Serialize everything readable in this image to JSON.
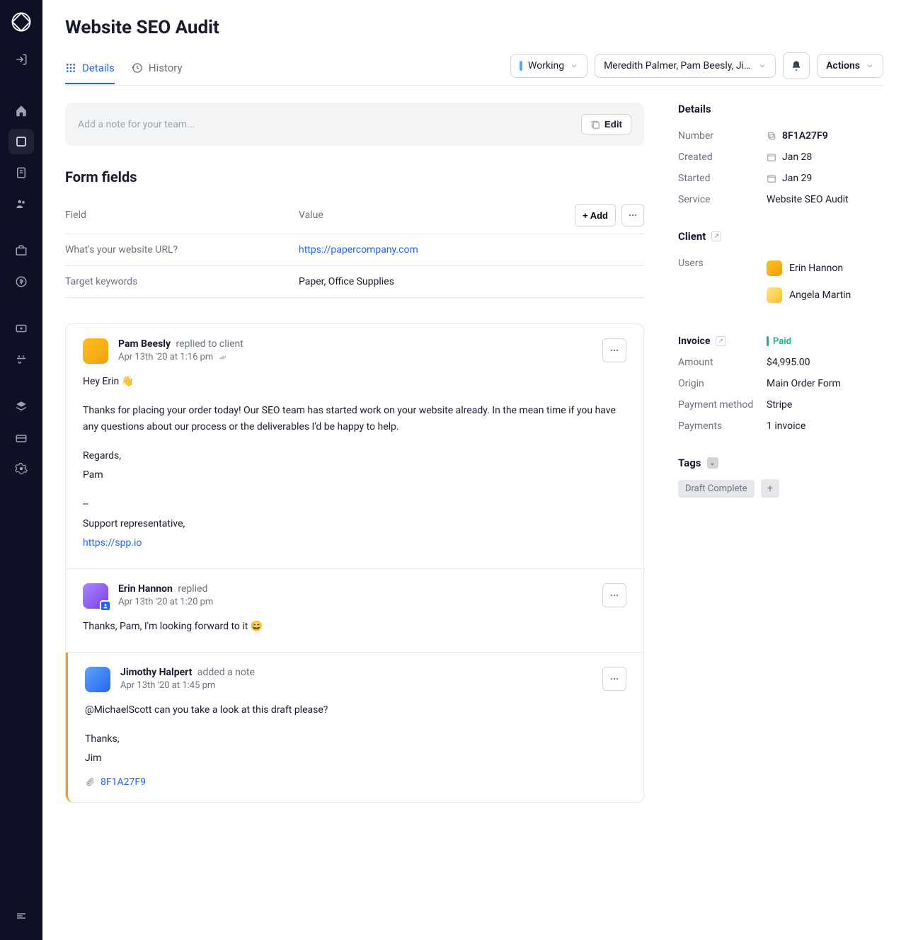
{
  "page": {
    "title": "Website SEO Audit"
  },
  "tabs": {
    "details": "Details",
    "history": "History"
  },
  "topbar": {
    "status": "Working",
    "assignees": "Meredith Palmer, Pam Beesly, Jimothy...",
    "actions": "Actions"
  },
  "note_input": {
    "placeholder": "Add a note for your team...",
    "edit": "Edit"
  },
  "form": {
    "heading": "Form fields",
    "col_field": "Field",
    "col_value": "Value",
    "add": "+ Add",
    "rows": [
      {
        "field": "What's your website URL?",
        "value": "https://papercompany.com",
        "is_link": true
      },
      {
        "field": "Target keywords",
        "value": "Paper, Office Supplies",
        "is_link": false
      }
    ]
  },
  "messages": [
    {
      "author": "Pam Beesly",
      "action": "replied to client",
      "time": "Apr 13th '20 at 1:16 pm",
      "read": true,
      "body": {
        "greeting": "Hey Erin 👋",
        "p1": "Thanks for placing your order today! Our SEO team has started work on your website already. In the mean time if you have any questions about our process or the deliverables I'd be happy to help.",
        "sig1": "Regards,",
        "sig2": "Pam",
        "dash": "--",
        "sig3": "Support representative,",
        "link": "https://spp.io"
      }
    },
    {
      "author": "Erin Hannon",
      "action": "replied",
      "time": "Apr 13th '20 at 1:20 pm",
      "body": {
        "p1": "Thanks, Pam, I'm looking forward to it 😄"
      }
    },
    {
      "author": "Jimothy Halpert",
      "action": "added a note",
      "time": "Apr 13th '20 at 1:45 pm",
      "body": {
        "p1": "@MichaelScott can you take a look at this draft please?",
        "sig1": "Thanks,",
        "sig2": "Jim"
      },
      "attachment": "8F1A27F9"
    }
  ],
  "details": {
    "heading": "Details",
    "number_label": "Number",
    "number": "8F1A27F9",
    "created_label": "Created",
    "created": "Jan 28",
    "started_label": "Started",
    "started": "Jan 29",
    "service_label": "Service",
    "service": "Website SEO Audit"
  },
  "client": {
    "heading": "Client",
    "users_label": "Users",
    "users": [
      "Erin Hannon",
      "Angela Martin"
    ]
  },
  "invoice": {
    "heading": "Invoice",
    "paid": "Paid",
    "amount_label": "Amount",
    "amount": "$4,995.00",
    "origin_label": "Origin",
    "origin": "Main Order Form",
    "method_label": "Payment method",
    "method": "Stripe",
    "payments_label": "Payments",
    "payments": "1 invoice"
  },
  "tags": {
    "heading": "Tags",
    "items": [
      "Draft Complete"
    ]
  }
}
